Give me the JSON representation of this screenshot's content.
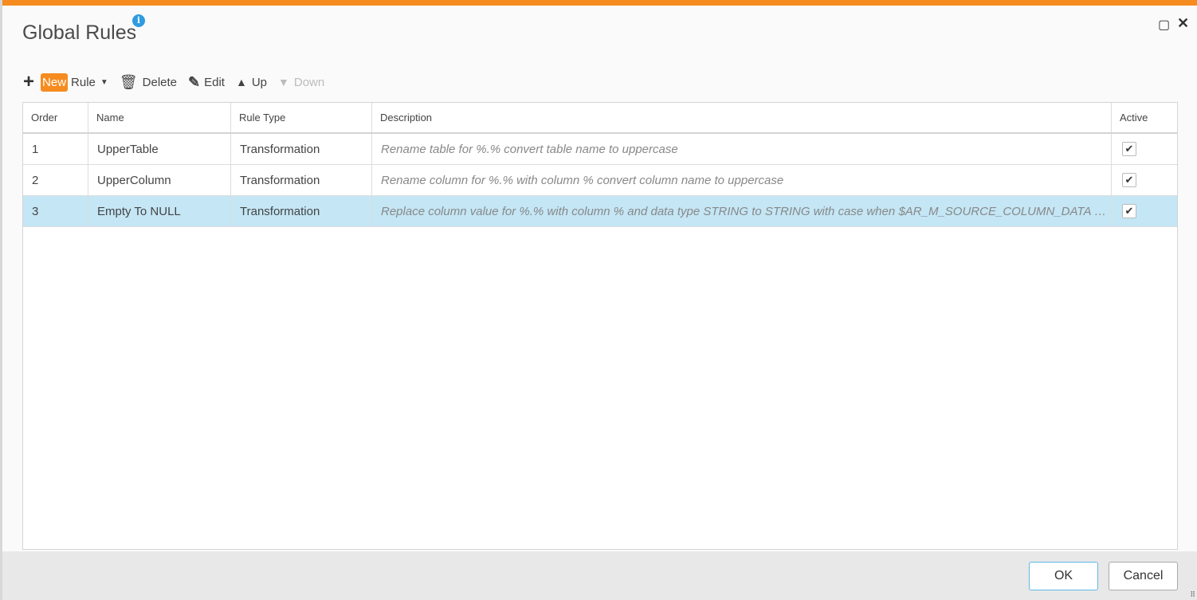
{
  "dialog": {
    "title": "Global Rules",
    "info_icon": "i"
  },
  "toolbar": {
    "new": "New",
    "rule": "Rule",
    "delete": "Delete",
    "edit": "Edit",
    "up": "Up",
    "down": "Down"
  },
  "table": {
    "headers": [
      "Order",
      "Name",
      "Rule Type",
      "Description",
      "Active"
    ],
    "rows": [
      {
        "order": "1",
        "name": "UpperTable",
        "type": "Transformation",
        "description": "Rename table for %.% convert table name to uppercase",
        "active": true
      },
      {
        "order": "2",
        "name": "UpperColumn",
        "type": "Transformation",
        "description": "Rename column for %.% with column % convert column name to uppercase",
        "active": true
      },
      {
        "order": "3",
        "name": "Empty To NULL",
        "type": "Transformation",
        "description": "Replace column value for %.% with column % and data type STRING to STRING with case when $AR_M_SOURCE_COLUMN_DATA = '' then NULL else $AR_M_SOURCE_COLUMN_DATA end",
        "active": true,
        "selected": true
      }
    ]
  },
  "footer": {
    "ok": "OK",
    "cancel": "Cancel"
  },
  "colors": {
    "accent": "#f68b1f",
    "selected": "#c4e6f5",
    "info": "#2f9be0"
  }
}
